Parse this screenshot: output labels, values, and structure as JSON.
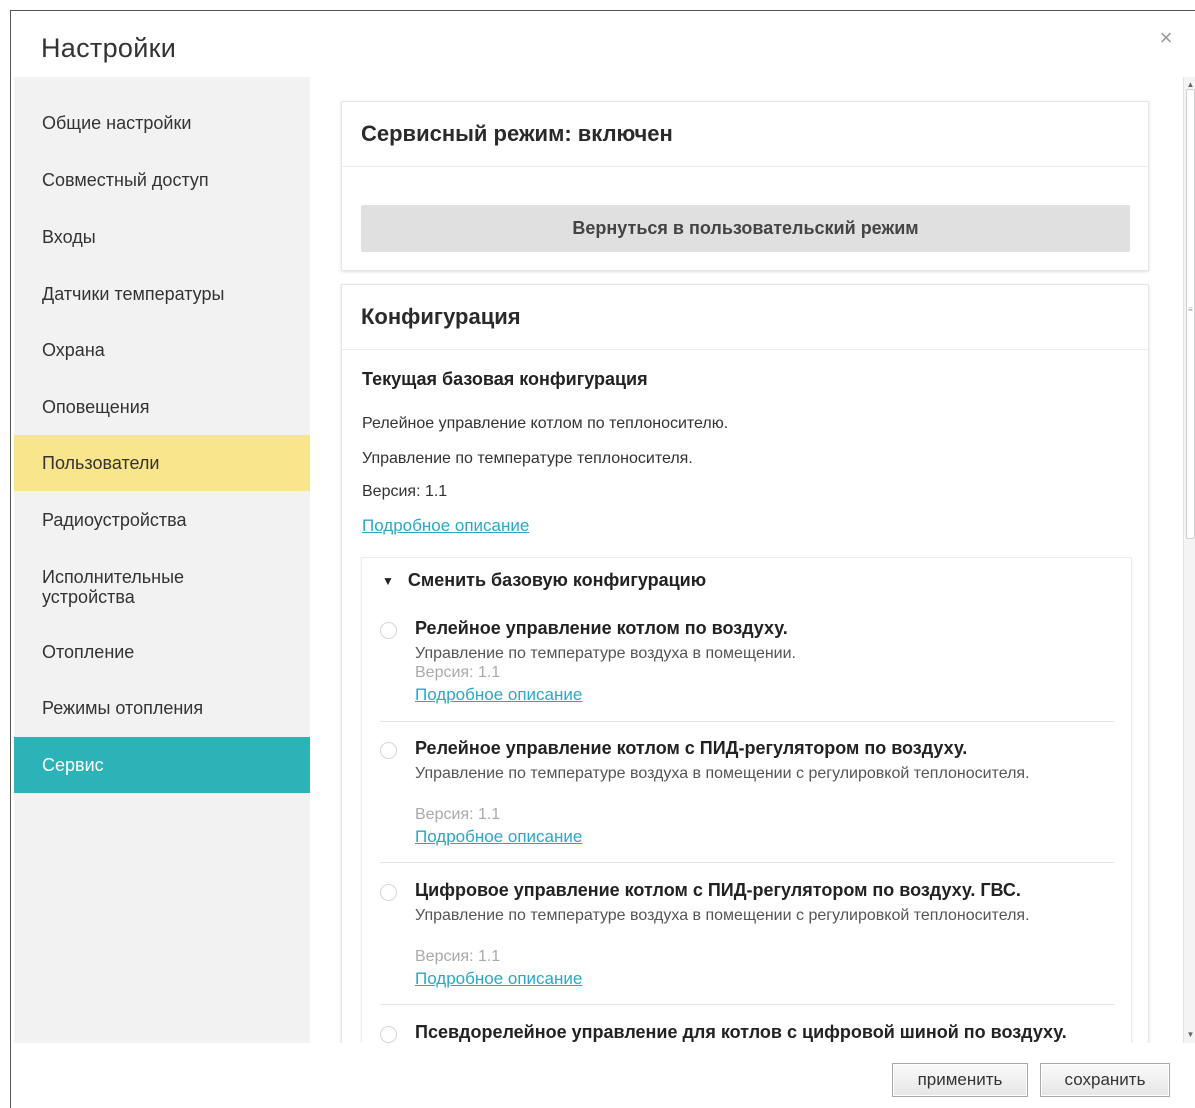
{
  "dialog": {
    "title": "Настройки",
    "close_label": "×"
  },
  "sidebar": {
    "items": [
      {
        "label": "Общие настройки"
      },
      {
        "label": "Совместный доступ"
      },
      {
        "label": "Входы"
      },
      {
        "label": "Датчики температуры"
      },
      {
        "label": "Охрана"
      },
      {
        "label": "Оповещения"
      },
      {
        "label": "Пользователи"
      },
      {
        "label": "Радиоустройства"
      },
      {
        "label": "Исполнительные устройства"
      },
      {
        "label": "Отопление"
      },
      {
        "label": "Режимы отопления"
      },
      {
        "label": "Сервис"
      }
    ],
    "highlight_color": "#f8e58c",
    "active_color": "#2bb3b8"
  },
  "service": {
    "title": "Сервисный режим: включен",
    "return_button": "Вернуться в пользовательский режим"
  },
  "config": {
    "title": "Конфигурация",
    "current_heading": "Текущая базовая конфигурация",
    "current_name": "Релейное управление котлом по теплоносителю.",
    "current_desc": "Управление по температуре теплоносителя.",
    "current_version": "Версия: 1.1",
    "current_link": "Подробное описание",
    "change_heading": "Сменить базовую конфигурацию",
    "options": [
      {
        "title": "Релейное управление котлом по воздуху.",
        "desc": "Управление по температуре воздуха в помещении.",
        "version": "Версия: 1.1",
        "link": "Подробное описание"
      },
      {
        "title": "Релейное управление котлом с ПИД-регулятором по воздуху.",
        "desc": "Управление по температуре воздуха в помещении с регулировкой теплоносителя.",
        "version": "Версия: 1.1",
        "link": "Подробное описание"
      },
      {
        "title": "Цифровое управление котлом с ПИД-регулятором по воздуху. ГВС.",
        "desc": "Управление по температуре воздуха в помещении с регулировкой теплоносителя.",
        "version": "Версия: 1.1",
        "link": "Подробное описание"
      },
      {
        "title": "Псевдорелейное управление для котлов с цифровой шиной по воздуху."
      }
    ]
  },
  "footer": {
    "apply": "применить",
    "save": "сохранить"
  },
  "icons": {
    "caret": "caret-down-icon",
    "scroll_up": "scroll-up-icon",
    "scroll_down": "scroll-down-icon"
  },
  "colors": {
    "link": "#2aa7c9"
  }
}
